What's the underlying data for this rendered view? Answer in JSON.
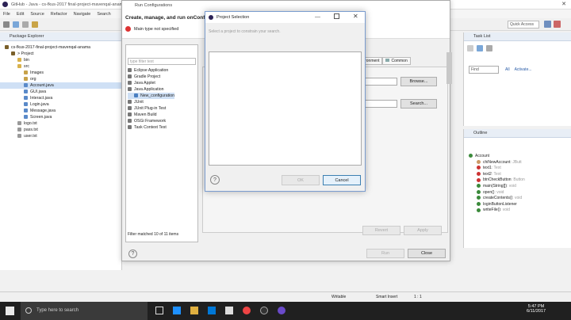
{
  "window": {
    "title": "GitHub - Java - cs-fkus-2017 final-project-mavenqal-anama...",
    "run_config_title": "Run Configurations"
  },
  "menu": [
    "File",
    "Edit",
    "Source",
    "Refactor",
    "Navigate",
    "Search"
  ],
  "quick_access": "Quick Access",
  "package_explorer": {
    "title": "Package Explorer",
    "items": [
      {
        "label": "cs-fkus-2017-final-project-mavenqal-anama",
        "indent": 0,
        "color": "#7a5f2a"
      },
      {
        "label": "> Project",
        "indent": 1,
        "color": "#7a5f2a"
      },
      {
        "label": "bin",
        "indent": 2,
        "color": "#d9b24c"
      },
      {
        "label": "src",
        "indent": 2,
        "color": "#d9b24c"
      },
      {
        "label": "Images",
        "indent": 3,
        "color": "#c7a24a"
      },
      {
        "label": "org",
        "indent": 3,
        "color": "#c7a24a"
      },
      {
        "label": "Account.java",
        "indent": 3,
        "color": "#5a8ac9"
      },
      {
        "label": "GUI.java",
        "indent": 3,
        "color": "#5a8ac9"
      },
      {
        "label": "Interact.java",
        "indent": 3,
        "color": "#5a8ac9"
      },
      {
        "label": "Login.java",
        "indent": 3,
        "color": "#5a8ac9"
      },
      {
        "label": "Message.java",
        "indent": 3,
        "color": "#5a8ac9"
      },
      {
        "label": "Screen.java",
        "indent": 3,
        "color": "#5a8ac9"
      },
      {
        "label": "logo.txt",
        "indent": 2,
        "color": "#999999"
      },
      {
        "label": "pass.txt",
        "indent": 2,
        "color": "#999999"
      },
      {
        "label": "user.txt",
        "indent": 2,
        "color": "#999999"
      }
    ]
  },
  "run_config": {
    "heading": "Create, manage, and run onConfig",
    "error": "Main type not specified",
    "filter_placeholder": "type filter text",
    "tree": [
      {
        "label": "Eclipse Application",
        "indent": 0
      },
      {
        "label": "Gradle Project",
        "indent": 0
      },
      {
        "label": "Java Applet",
        "indent": 0
      },
      {
        "label": "Java Application",
        "indent": 0
      },
      {
        "label": "New_configuration",
        "indent": 1
      },
      {
        "label": "JUnit",
        "indent": 0
      },
      {
        "label": "JUnit Plug-in Test",
        "indent": 0
      },
      {
        "label": "Maven Build",
        "indent": 0
      },
      {
        "label": "OSGi Framework",
        "indent": 0
      },
      {
        "label": "Task Context Test",
        "indent": 0
      }
    ],
    "filter_status": "Filter matched 10 of 11 items",
    "tabs": [
      "ironment",
      "Common"
    ],
    "browse_label": "Browse...",
    "search_label": "Search...",
    "revert_label": "Revert",
    "apply_label": "Apply",
    "run_label": "Run",
    "close_label": "Close"
  },
  "project_selection": {
    "title": "Project Selection",
    "prompt": "Select a project to constrain your search.",
    "ok_label": "OK",
    "cancel_label": "Cancel"
  },
  "task_list": {
    "title": "Task List",
    "find_placeholder": "Find",
    "all_label": "All",
    "activate_label": "Activate..."
  },
  "outline": {
    "title": "Outline",
    "items": [
      {
        "label": "Account",
        "meta": "",
        "indent": 0,
        "color": "#3b8a3b"
      },
      {
        "label": "chiNewAccount",
        "meta": ": JButt",
        "indent": 1,
        "color": "#c96"
      },
      {
        "label": "text1",
        "meta": ": Text",
        "indent": 1,
        "color": "#c33"
      },
      {
        "label": "text2",
        "meta": ": Text",
        "indent": 1,
        "color": "#c33"
      },
      {
        "label": "btnCheckButton",
        "meta": ": Button",
        "indent": 1,
        "color": "#c33"
      },
      {
        "label": "main(String[])",
        "meta": ": void",
        "indent": 1,
        "color": "#3b8a3b"
      },
      {
        "label": "open()",
        "meta": ": void",
        "indent": 1,
        "color": "#3b8a3b"
      },
      {
        "label": "createContents()",
        "meta": ": void",
        "indent": 1,
        "color": "#3b8a3b"
      },
      {
        "label": "loginButtonListener",
        "meta": "",
        "indent": 1,
        "color": "#3b8a3b"
      },
      {
        "label": "writeFile()",
        "meta": ": void",
        "indent": 1,
        "color": "#3b8a3b"
      }
    ]
  },
  "status_bar": {
    "writable": "Writable",
    "insert_mode": "Smart Insert",
    "position": "1 : 1"
  },
  "taskbar": {
    "search_placeholder": "Type here to search",
    "time": "5:47 PM",
    "date": "6/11/2017"
  }
}
